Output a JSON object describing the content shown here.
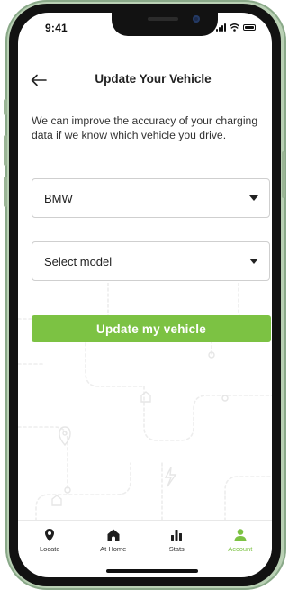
{
  "status_bar": {
    "time": "9:41"
  },
  "header": {
    "title": "Update Your Vehicle",
    "back_icon": "arrow-left-icon"
  },
  "description": "We can improve the accuracy of your charging data if we know which vehicle you drive.",
  "make_select": {
    "value": "BMW"
  },
  "model_select": {
    "value": "Select model"
  },
  "update_button": {
    "label": "Update my vehicle"
  },
  "tabs": [
    {
      "label": "Locate",
      "icon": "location-pin-icon",
      "active": false
    },
    {
      "label": "At Home",
      "icon": "home-icon",
      "active": false
    },
    {
      "label": "Stats",
      "icon": "bar-chart-icon",
      "active": false
    },
    {
      "label": "Account",
      "icon": "user-icon",
      "active": true
    }
  ],
  "colors": {
    "accent": "#7cc243",
    "text": "#222222",
    "border": "#cfcfcf",
    "frame": "#b9d0b4"
  }
}
